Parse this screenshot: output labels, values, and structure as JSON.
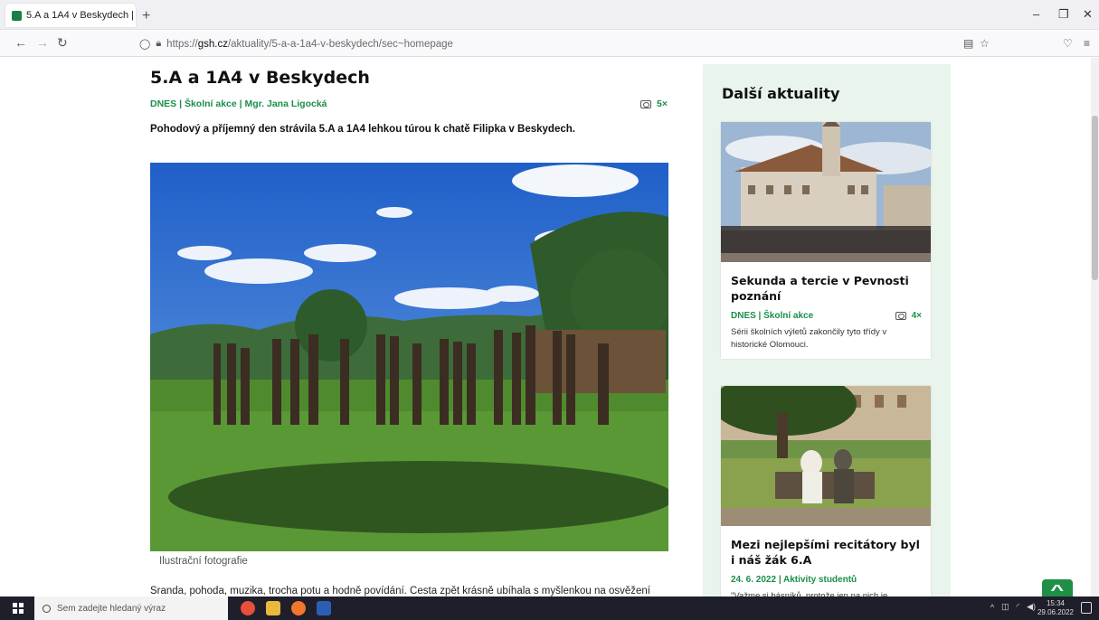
{
  "browser": {
    "tab_title": "5.A a 1A4 v Beskydech | ×",
    "url_prefix": "https://",
    "url_host": "gsh.cz",
    "url_path": "/aktuality/5-a-a-1a4-v-beskydech/sec~homepage"
  },
  "article": {
    "title": "5.A a 1A4 v Beskydech",
    "meta": "DNES | Školní akce | Mgr. Jana Ligocká",
    "photo_count": "5×",
    "perex": "Pohodový a příjemný den strávila 5.A a 1A4 lehkou túrou k chatě Filipka v Beskydech.",
    "caption": "Ilustrační fotografie",
    "body_first_line": "Sranda, pohoda, muzika, trocha potu a hodně povídání. Cesta zpět krásně ubíhala s myšlenkou na osvěžení"
  },
  "sidebar": {
    "heading": "Další aktuality",
    "cards": [
      {
        "title": "Sekunda a tercie v Pevnosti poznání",
        "meta": "DNES | Školní akce",
        "photo_count": "4×",
        "description": "Sérii školních výletů zakončily tyto třídy v historické Olomouci."
      },
      {
        "title": "Mezi nejlepšími recitátory byl i náš žák 6.A",
        "meta": "24. 6. 2022 | Aktivity studentů",
        "photo_count": "",
        "description": "\"Važme si básníků, protože jen na nich je"
      }
    ]
  },
  "taskbar": {
    "search_placeholder": "Sem zadejte hledaný výraz",
    "time": "15:34",
    "date": "29.06.2022"
  },
  "colors": {
    "accent_green": "#1b8e4a",
    "sidebar_bg": "#e8f4ec",
    "backtop_bg": "#1f8f48"
  }
}
